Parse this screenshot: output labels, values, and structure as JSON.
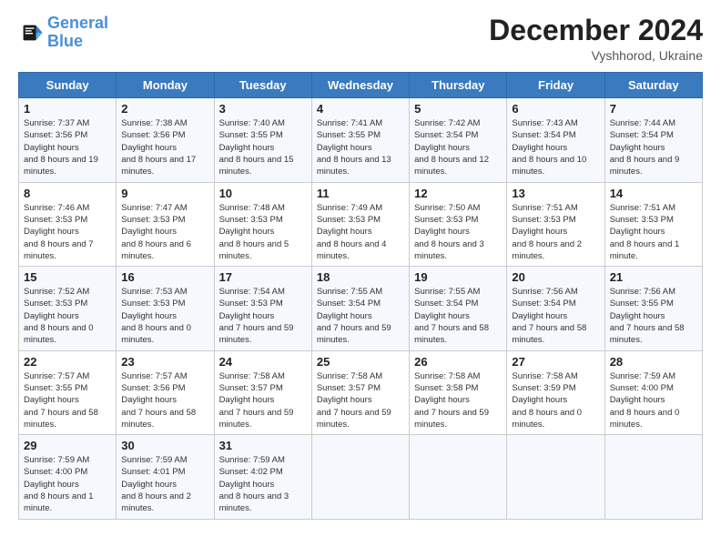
{
  "logo": {
    "line1": "General",
    "line2": "Blue"
  },
  "header": {
    "month_year": "December 2024",
    "location": "Vyshhorod, Ukraine"
  },
  "weekdays": [
    "Sunday",
    "Monday",
    "Tuesday",
    "Wednesday",
    "Thursday",
    "Friday",
    "Saturday"
  ],
  "weeks": [
    [
      {
        "day": "1",
        "sunrise": "7:37 AM",
        "sunset": "3:56 PM",
        "daylight": "8 hours and 19 minutes."
      },
      {
        "day": "2",
        "sunrise": "7:38 AM",
        "sunset": "3:56 PM",
        "daylight": "8 hours and 17 minutes."
      },
      {
        "day": "3",
        "sunrise": "7:40 AM",
        "sunset": "3:55 PM",
        "daylight": "8 hours and 15 minutes."
      },
      {
        "day": "4",
        "sunrise": "7:41 AM",
        "sunset": "3:55 PM",
        "daylight": "8 hours and 13 minutes."
      },
      {
        "day": "5",
        "sunrise": "7:42 AM",
        "sunset": "3:54 PM",
        "daylight": "8 hours and 12 minutes."
      },
      {
        "day": "6",
        "sunrise": "7:43 AM",
        "sunset": "3:54 PM",
        "daylight": "8 hours and 10 minutes."
      },
      {
        "day": "7",
        "sunrise": "7:44 AM",
        "sunset": "3:54 PM",
        "daylight": "8 hours and 9 minutes."
      }
    ],
    [
      {
        "day": "8",
        "sunrise": "7:46 AM",
        "sunset": "3:53 PM",
        "daylight": "8 hours and 7 minutes."
      },
      {
        "day": "9",
        "sunrise": "7:47 AM",
        "sunset": "3:53 PM",
        "daylight": "8 hours and 6 minutes."
      },
      {
        "day": "10",
        "sunrise": "7:48 AM",
        "sunset": "3:53 PM",
        "daylight": "8 hours and 5 minutes."
      },
      {
        "day": "11",
        "sunrise": "7:49 AM",
        "sunset": "3:53 PM",
        "daylight": "8 hours and 4 minutes."
      },
      {
        "day": "12",
        "sunrise": "7:50 AM",
        "sunset": "3:53 PM",
        "daylight": "8 hours and 3 minutes."
      },
      {
        "day": "13",
        "sunrise": "7:51 AM",
        "sunset": "3:53 PM",
        "daylight": "8 hours and 2 minutes."
      },
      {
        "day": "14",
        "sunrise": "7:51 AM",
        "sunset": "3:53 PM",
        "daylight": "8 hours and 1 minute."
      }
    ],
    [
      {
        "day": "15",
        "sunrise": "7:52 AM",
        "sunset": "3:53 PM",
        "daylight": "8 hours and 0 minutes."
      },
      {
        "day": "16",
        "sunrise": "7:53 AM",
        "sunset": "3:53 PM",
        "daylight": "8 hours and 0 minutes."
      },
      {
        "day": "17",
        "sunrise": "7:54 AM",
        "sunset": "3:53 PM",
        "daylight": "7 hours and 59 minutes."
      },
      {
        "day": "18",
        "sunrise": "7:55 AM",
        "sunset": "3:54 PM",
        "daylight": "7 hours and 59 minutes."
      },
      {
        "day": "19",
        "sunrise": "7:55 AM",
        "sunset": "3:54 PM",
        "daylight": "7 hours and 58 minutes."
      },
      {
        "day": "20",
        "sunrise": "7:56 AM",
        "sunset": "3:54 PM",
        "daylight": "7 hours and 58 minutes."
      },
      {
        "day": "21",
        "sunrise": "7:56 AM",
        "sunset": "3:55 PM",
        "daylight": "7 hours and 58 minutes."
      }
    ],
    [
      {
        "day": "22",
        "sunrise": "7:57 AM",
        "sunset": "3:55 PM",
        "daylight": "7 hours and 58 minutes."
      },
      {
        "day": "23",
        "sunrise": "7:57 AM",
        "sunset": "3:56 PM",
        "daylight": "7 hours and 58 minutes."
      },
      {
        "day": "24",
        "sunrise": "7:58 AM",
        "sunset": "3:57 PM",
        "daylight": "7 hours and 59 minutes."
      },
      {
        "day": "25",
        "sunrise": "7:58 AM",
        "sunset": "3:57 PM",
        "daylight": "7 hours and 59 minutes."
      },
      {
        "day": "26",
        "sunrise": "7:58 AM",
        "sunset": "3:58 PM",
        "daylight": "7 hours and 59 minutes."
      },
      {
        "day": "27",
        "sunrise": "7:58 AM",
        "sunset": "3:59 PM",
        "daylight": "8 hours and 0 minutes."
      },
      {
        "day": "28",
        "sunrise": "7:59 AM",
        "sunset": "4:00 PM",
        "daylight": "8 hours and 0 minutes."
      }
    ],
    [
      {
        "day": "29",
        "sunrise": "7:59 AM",
        "sunset": "4:00 PM",
        "daylight": "8 hours and 1 minute."
      },
      {
        "day": "30",
        "sunrise": "7:59 AM",
        "sunset": "4:01 PM",
        "daylight": "8 hours and 2 minutes."
      },
      {
        "day": "31",
        "sunrise": "7:59 AM",
        "sunset": "4:02 PM",
        "daylight": "8 hours and 3 minutes."
      },
      null,
      null,
      null,
      null
    ]
  ]
}
